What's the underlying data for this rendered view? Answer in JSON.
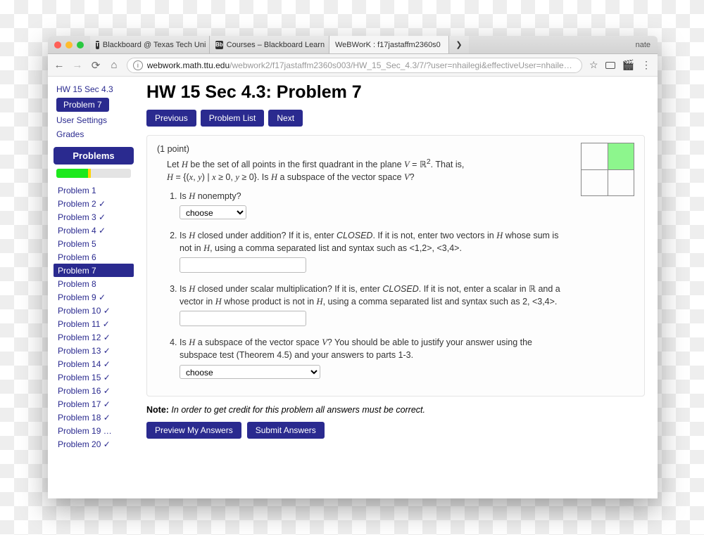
{
  "browser": {
    "tabs": [
      {
        "title": "Blackboard @ Texas Tech Uni",
        "icon": "T"
      },
      {
        "title": "Courses – Blackboard Learn",
        "icon": "Bb"
      },
      {
        "title": "WeBWorK : f17jastaffm2360s0",
        "icon": ""
      }
    ],
    "profile": "nate",
    "url_host": "webwork.math.ttu.edu",
    "url_path": "/webwork2/f17jastaffm2360s003/HW_15_Sec_4.3/7/?user=nhailegi&effectiveUser=nhailegi&…"
  },
  "sidebar": {
    "top_links": [
      "HW 15 Sec 4.3"
    ],
    "current_pill": "Problem 7",
    "extra_links": [
      "User Settings",
      "Grades"
    ],
    "problems_header": "Problems",
    "progress": {
      "green_pct": 42,
      "yellow_pct": 4
    },
    "problems": [
      {
        "label": "Problem 1",
        "check": false,
        "current": false
      },
      {
        "label": "Problem 2",
        "check": true,
        "current": false
      },
      {
        "label": "Problem 3",
        "check": true,
        "current": false
      },
      {
        "label": "Problem 4",
        "check": true,
        "current": false
      },
      {
        "label": "Problem 5",
        "check": false,
        "current": false
      },
      {
        "label": "Problem 6",
        "check": false,
        "current": false
      },
      {
        "label": "Problem 7",
        "check": false,
        "current": true
      },
      {
        "label": "Problem 8",
        "check": false,
        "current": false
      },
      {
        "label": "Problem 9",
        "check": true,
        "current": false
      },
      {
        "label": "Problem 10",
        "check": true,
        "current": false
      },
      {
        "label": "Problem 11",
        "check": true,
        "current": false
      },
      {
        "label": "Problem 12",
        "check": true,
        "current": false
      },
      {
        "label": "Problem 13",
        "check": true,
        "current": false
      },
      {
        "label": "Problem 14",
        "check": true,
        "current": false
      },
      {
        "label": "Problem 15",
        "check": true,
        "current": false
      },
      {
        "label": "Problem 16",
        "check": true,
        "current": false
      },
      {
        "label": "Problem 17",
        "check": true,
        "current": false
      },
      {
        "label": "Problem 18",
        "check": true,
        "current": false
      },
      {
        "label": "Problem 19 …",
        "check": false,
        "current": false
      },
      {
        "label": "Problem 20",
        "check": true,
        "current": false
      }
    ]
  },
  "main": {
    "title": "HW 15 Sec 4.3: Problem 7",
    "nav": {
      "previous": "Previous",
      "list": "Problem List",
      "next": "Next"
    },
    "points": "(1 point)",
    "intro_pre": "Let ",
    "intro_mid1": " be the set of all points in the first quadrant in the plane ",
    "intro_mid2": ". That is, ",
    "intro_mid3": ". Is ",
    "intro_mid4": " a subspace of the vector space ",
    "intro_end": "?",
    "q1_pre": "Is ",
    "q1_post": " nonempty?",
    "q1_choose": "choose",
    "q2_pre": "Is ",
    "q2_mid": " closed under addition? If it is, enter ",
    "q2_closed": "CLOSED",
    "q2_mid2": ". If it is not, enter two vectors in ",
    "q2_mid3": " whose sum is not in ",
    "q2_mid4": ", using a comma separated list and syntax such as ",
    "q2_example": "<1,2>, <3,4>.",
    "q3_pre": "Is ",
    "q3_mid": " closed under scalar multiplication? If it is, enter ",
    "q3_closed": "CLOSED",
    "q3_mid2": ". If it is not, enter a scalar in ",
    "q3_mid3": " and a vector in ",
    "q3_mid4": " whose product is not in ",
    "q3_mid5": ", using a comma separated list and syntax such as ",
    "q3_example": "2, <3,4>.",
    "q4_pre": "Is ",
    "q4_mid": " a subspace of the vector space ",
    "q4_post": "? You should be able to justify your answer using the subspace test (Theorem 4.5) and your answers to parts 1-3.",
    "q4_choose": "choose",
    "note_label": "Note:",
    "note_text": " In order to get credit for this problem all answers must be correct.",
    "preview": "Preview My Answers",
    "submit": "Submit Answers"
  }
}
